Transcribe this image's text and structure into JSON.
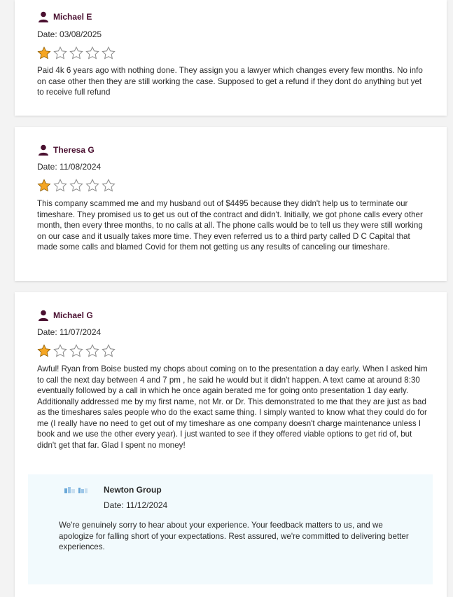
{
  "reviews": [
    {
      "name": "Michael E",
      "date": "Date: 03/08/2025",
      "rating": 1,
      "max_rating": 5,
      "text": "Paid 4k 6 years ago with nothing done. They assign you a lawyer which changes every few months. No info on case other then they are still working the case. Supposed to get a refund if they dont do anything but yet to receive full refund"
    },
    {
      "name": "Theresa G",
      "date": "Date: 11/08/2024",
      "rating": 1,
      "max_rating": 5,
      "text": "This company scammed me and my husband out of $4495 because they didn't help us to terminate our timeshare. They promised us to get us out of the contract and didn't. Initially, we got phone calls every other month, then every three months, to no calls at all. The phone calls would be to tell us they were still working on our case and it usually takes more time. They even referred us to a third party called D C Capital that made some calls and blamed Covid for them not getting us any results of canceling our timeshare."
    },
    {
      "name": "Michael G",
      "date": "Date: 11/07/2024",
      "rating": 1,
      "max_rating": 5,
      "text": "Awful! Ryan from Boise busted my chops about coming on to the presentation a day early. When I asked him to call the next day between 4 and 7 pm , he said he would but it didn't happen. A text came at around 8:30 eventually followed by a call in which he once again berated me for going onto presentation 1 day early. Additionally addressed me by my first name, not Mr. or Dr. This demonstrated to me that they are just as bad as the timeshares sales people who do the exact same thing. I simply wanted to know what they could do for me (I really have no need to get out of my timeshare as one company doesn't charge maintenance unless I book and we use the other every year). I just wanted to see if they offered viable options to get rid of, but didn't get that far. Glad I spent no money!",
      "reply": {
        "name": "Newton Group",
        "date": "Date: 11/12/2024",
        "text": "We're genuinely sorry to hear about your experience. Your feedback matters to us, and we apologize for falling short of your expectations. Rest assured, we're committed to delivering better experiences."
      }
    }
  ],
  "colors": {
    "name": "#4a1030",
    "star_filled": "#f5a623",
    "star_empty_stroke": "#8a8a8a",
    "reply_bg": "#f2fafd"
  },
  "icons": {
    "user": "person-icon",
    "star": "star-icon",
    "logo": "newton-group-logo"
  }
}
